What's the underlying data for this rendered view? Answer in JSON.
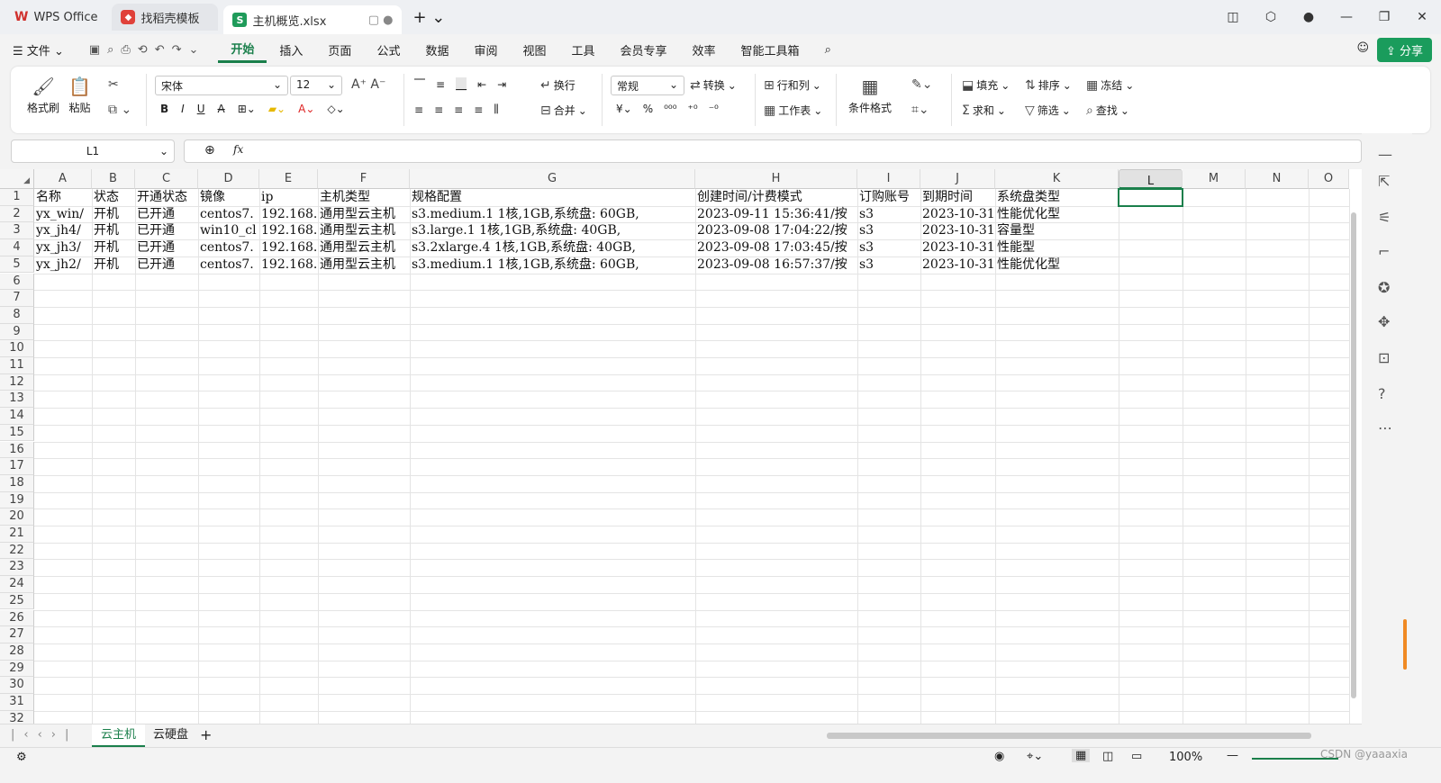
{
  "tabs": [
    {
      "label": "WPS Office"
    },
    {
      "label": "找稻壳模板"
    },
    {
      "label": "主机概览.xlsx"
    }
  ],
  "menu": {
    "file": "文件",
    "items": [
      "开始",
      "插入",
      "页面",
      "公式",
      "数据",
      "审阅",
      "视图",
      "工具",
      "会员专享",
      "效率",
      "智能工具箱"
    ],
    "share": "分享"
  },
  "ribbon": {
    "format_painter": "格式刷",
    "paste": "粘贴",
    "font": "宋体",
    "size": "12",
    "wrap": "换行",
    "merge": "合并",
    "numfmt": "常规",
    "convert": "转换",
    "rowcol": "行和列",
    "worksheet": "工作表",
    "condfmt": "条件格式",
    "fill": "填充",
    "sort": "排序",
    "freeze": "冻结",
    "sum": "求和",
    "filter": "筛选",
    "find": "查找"
  },
  "namebox": "L1",
  "columns": [
    "A",
    "B",
    "C",
    "D",
    "E",
    "F",
    "G",
    "H",
    "I",
    "J",
    "K",
    "L",
    "M",
    "N",
    "O"
  ],
  "rows": [
    [
      "名称",
      "状态",
      "开通状态",
      "镜像",
      "ip",
      "主机类型",
      "规格配置",
      "创建时间/计费模式",
      "订购账号",
      "到期时间",
      "系统盘类型"
    ],
    [
      "yx_win/",
      "开机",
      "已开通",
      "centos7.",
      "192.168.",
      "通用型云主机",
      "s3.medium.1     1核,1GB,系统盘: 60GB,",
      "2023-09-11 15:36:41/按",
      "s3",
      "2023-10-31",
      "性能优化型"
    ],
    [
      "yx_jh4/",
      "开机",
      "已开通",
      "win10_cl",
      "192.168.",
      "通用型云主机",
      "s3.large.1    1核,1GB,系统盘: 40GB,",
      "2023-09-08 17:04:22/按",
      "s3",
      "2023-10-31",
      "容量型"
    ],
    [
      "yx_jh3/",
      "开机",
      "已开通",
      "centos7.",
      "192.168.",
      "通用型云主机",
      "s3.2xlarge.4    1核,1GB,系统盘: 40GB,",
      "2023-09-08 17:03:45/按",
      "s3",
      "2023-10-31",
      "性能型"
    ],
    [
      "yx_jh2/",
      "开机",
      "已开通",
      "centos7.",
      "192.168.",
      "通用型云主机",
      "s3.medium.1     1核,1GB,系统盘: 60GB,",
      "2023-09-08 16:57:37/按",
      "s3",
      "2023-10-31",
      "性能优化型"
    ]
  ],
  "sheets": [
    "云主机",
    "云硬盘"
  ],
  "status": {
    "zoom": "100%",
    "watermark": "CSDN @yaaaxia"
  },
  "colors": {
    "accent": "#1a7f4b"
  }
}
